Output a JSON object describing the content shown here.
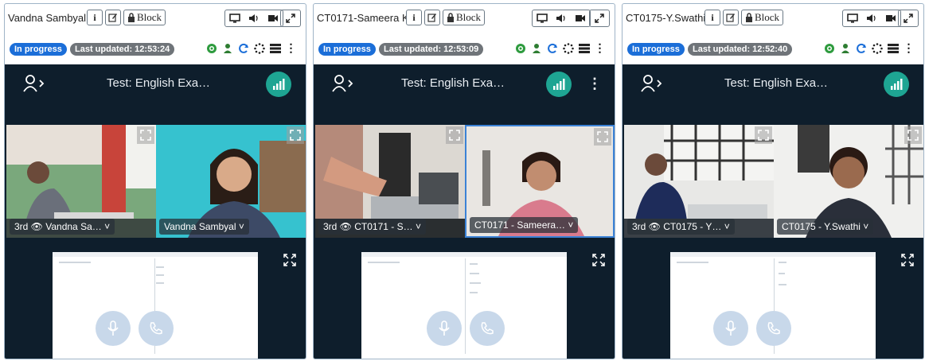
{
  "panels": [
    {
      "name": "Vandna Sambyal",
      "info_label": "i",
      "block_label": "Block",
      "status": "In progress",
      "last_updated": "Last updated: 12:53:24",
      "test_title": "Test: English Exa…",
      "tiles": [
        {
          "label": "3rd 👁 Vandna Sa…  ˅"
        },
        {
          "label": "Vandna Sambyal  ˅"
        }
      ]
    },
    {
      "name": "CT0171-Sameera K.",
      "info_label": "i",
      "block_label": "Block",
      "status": "In progress",
      "last_updated": "Last updated: 12:53:09",
      "test_title": "Test: English Exa…",
      "tiles": [
        {
          "label": "3rd 👁 CT0171 - S…  ˅"
        },
        {
          "label": "CT0171 - Sameera…  ˅"
        }
      ]
    },
    {
      "name": "CT0175-Y.Swathi",
      "info_label": "i",
      "block_label": "Block",
      "status": "In progress",
      "last_updated": "Last updated: 12:52:40",
      "test_title": "Test: English Exa…",
      "tiles": [
        {
          "label": "3rd 👁 CT0175 - Y…  ˅"
        },
        {
          "label": "CT0175 - Y.Swathi  ˅"
        }
      ]
    }
  ],
  "colors": {
    "in_progress": "#1b6ed8",
    "last_updated": "#6f7479",
    "dark_bg": "#0e1e2c",
    "signal": "#1ea593",
    "accent_border": "#3b82d6"
  },
  "icons": [
    "info-icon",
    "edit-icon",
    "lock-icon",
    "monitor-icon",
    "speaker-icon",
    "camera-icon",
    "expand-icon",
    "eye-icon",
    "user-icon",
    "refresh-icon",
    "loading-icon",
    "list-icon",
    "kebab-icon",
    "user-arrow-icon",
    "signal-icon",
    "fullscreen-icon",
    "microphone-icon",
    "phone-icon"
  ]
}
